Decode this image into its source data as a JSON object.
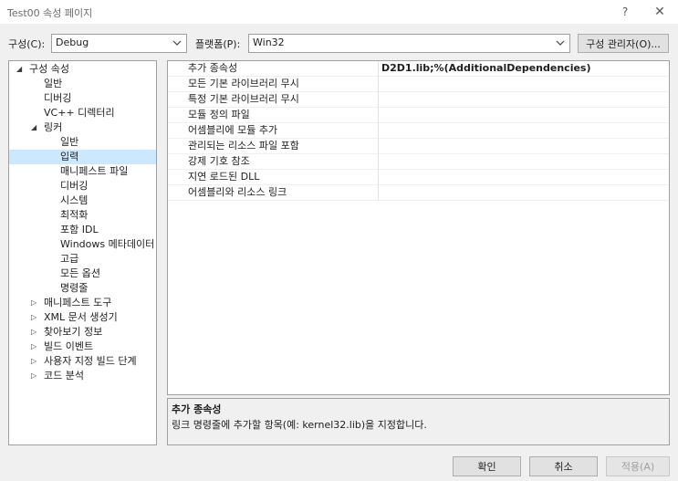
{
  "window": {
    "title": "Test00 속성 페이지",
    "help_label": "?",
    "close_label": "✕"
  },
  "toolbar": {
    "config_label": "구성(C):",
    "config_value": "Debug",
    "platform_label": "플랫폼(P):",
    "platform_value": "Win32",
    "manager_label": "구성 관리자(O)..."
  },
  "tree": {
    "items": [
      {
        "label": "구성 속성",
        "expander": "◢"
      },
      {
        "label": "일반"
      },
      {
        "label": "디버깅"
      },
      {
        "label": "VC++ 디렉터리"
      },
      {
        "label": "링커",
        "expander": "◢"
      },
      {
        "label": "일반"
      },
      {
        "label": "입력",
        "selected": true
      },
      {
        "label": "매니페스트 파일"
      },
      {
        "label": "디버깅"
      },
      {
        "label": "시스템"
      },
      {
        "label": "최적화"
      },
      {
        "label": "포함 IDL"
      },
      {
        "label": "Windows 메타데이터"
      },
      {
        "label": "고급"
      },
      {
        "label": "모든 옵션"
      },
      {
        "label": "명령줄"
      },
      {
        "label": "매니페스트 도구",
        "expander": "▷"
      },
      {
        "label": "XML 문서 생성기",
        "expander": "▷"
      },
      {
        "label": "찾아보기 정보",
        "expander": "▷"
      },
      {
        "label": "빌드 이벤트",
        "expander": "▷"
      },
      {
        "label": "사용자 지정 빌드 단계",
        "expander": "▷"
      },
      {
        "label": "코드 분석",
        "expander": "▷"
      }
    ]
  },
  "grid": {
    "rows": [
      {
        "name": "추가 종속성",
        "value": "D2D1.lib;%(AdditionalDependencies)"
      },
      {
        "name": "모든 기본 라이브러리 무시",
        "value": ""
      },
      {
        "name": "특정 기본 라이브러리 무시",
        "value": ""
      },
      {
        "name": "모듈 정의 파일",
        "value": ""
      },
      {
        "name": "어셈블리에 모듈 추가",
        "value": ""
      },
      {
        "name": "관리되는 리소스 파일 포함",
        "value": ""
      },
      {
        "name": "강제 기호 참조",
        "value": ""
      },
      {
        "name": "지연 로드된 DLL",
        "value": ""
      },
      {
        "name": "어셈블리와 리소스 링크",
        "value": ""
      }
    ]
  },
  "description": {
    "title": "추가 종속성",
    "text": "링크 명령줄에 추가할 항목(예: kernel32.lib)을 지정합니다."
  },
  "buttons": {
    "ok": "확인",
    "cancel": "취소",
    "apply": "적용(A)"
  }
}
